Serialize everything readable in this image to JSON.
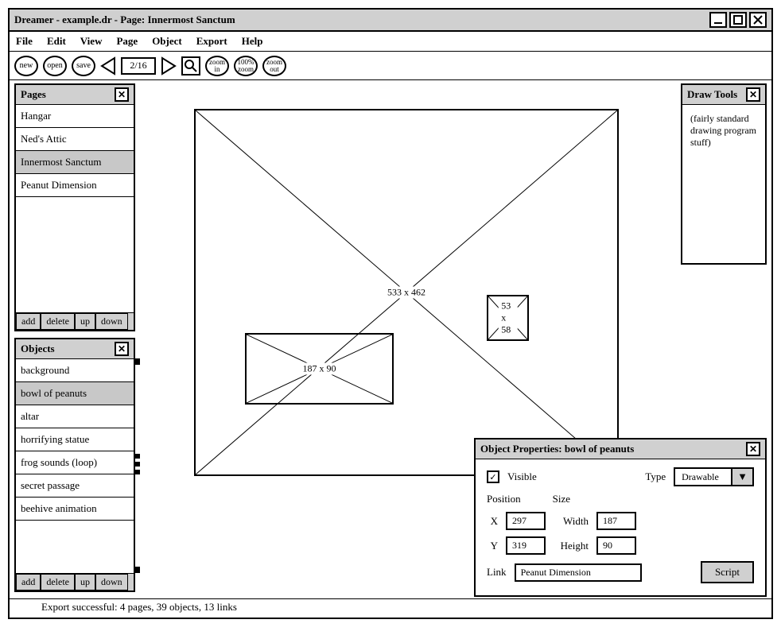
{
  "window": {
    "title": "Dreamer - example.dr - Page: Innermost Sanctum"
  },
  "menu": {
    "file": "File",
    "edit": "Edit",
    "view": "View",
    "page": "Page",
    "object": "Object",
    "export": "Export",
    "help": "Help"
  },
  "toolbar": {
    "new": "new",
    "open": "open",
    "save": "save",
    "page_indicator": "2/16",
    "zoom_in_top": "zoom",
    "zoom_in_bot": "in",
    "zoom_100_top": "100%",
    "zoom_100_bot": "zoom",
    "zoom_out_top": "zoom",
    "zoom_out_bot": "out"
  },
  "pages_panel": {
    "title": "Pages",
    "items": [
      "Hangar",
      "Ned's Attic",
      "Innermost Sanctum",
      "Peanut Dimension"
    ],
    "selected_index": 2,
    "buttons": {
      "add": "add",
      "delete": "delete",
      "up": "up",
      "down": "down"
    }
  },
  "objects_panel": {
    "title": "Objects",
    "items": [
      "background",
      "bowl of peanuts",
      "altar",
      "horrifying statue",
      "frog sounds (loop)",
      "secret passage",
      "beehive animation"
    ],
    "selected_index": 1,
    "buttons": {
      "add": "add",
      "delete": "delete",
      "up": "up",
      "down": "down"
    }
  },
  "drawtools_panel": {
    "title": "Draw Tools",
    "body": "(fairly standard drawing program stuff)"
  },
  "canvas": {
    "bg": {
      "label": "533 x 462"
    },
    "obj1": {
      "label": "187 x 90"
    },
    "obj2": {
      "label": "53 x 58"
    }
  },
  "objprops_panel": {
    "title": "Object Properties: bowl of peanuts",
    "visible_label": "Visible",
    "visible_checked": true,
    "type_label": "Type",
    "type_value": "Drawable",
    "position_label": "Position",
    "x_label": "X",
    "x_value": "297",
    "y_label": "Y",
    "y_value": "319",
    "size_label": "Size",
    "width_label": "Width",
    "width_value": "187",
    "height_label": "Height",
    "height_value": "90",
    "link_label": "Link",
    "link_value": "Peanut Dimension",
    "script_button": "Script"
  },
  "status": "Export successful: 4 pages, 39 objects, 13 links"
}
